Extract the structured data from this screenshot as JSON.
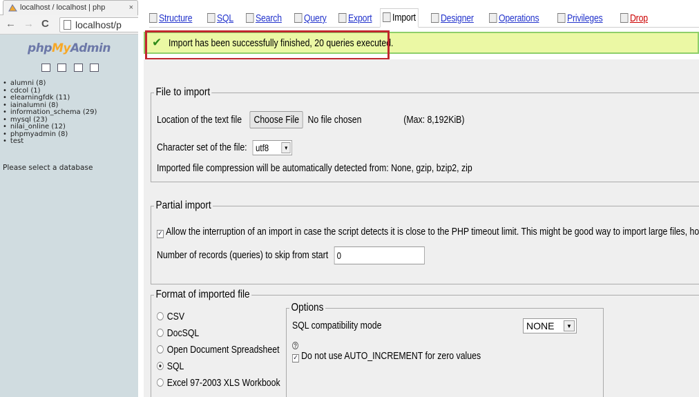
{
  "browser": {
    "tab_title": "localhost / localhost | php",
    "tab_close": "×",
    "url": "localhost/p",
    "back": "←",
    "forward": "→",
    "reload": "C"
  },
  "sidebar": {
    "logo": {
      "part1": "php",
      "part2": "My",
      "part3": "Admin"
    },
    "databases": [
      "alumni (8)",
      "cdcol (1)",
      "elearningfdk (11)",
      "iainalumni (8)",
      "information_schema (29)",
      "mysql (23)",
      "nilai_online (12)",
      "phpmyadmin (8)",
      "test"
    ],
    "select_message": "Please select a database"
  },
  "menu": {
    "structure": "Structure",
    "sql": "SQL",
    "search": "Search",
    "query": "Query",
    "export": "Export",
    "import": "Import",
    "designer": "Designer",
    "operations": "Operations",
    "privileges": "Privileges",
    "drop": "Drop"
  },
  "success": {
    "message": "Import has been successfully finished, 20 queries executed."
  },
  "file_import": {
    "legend": "File to import",
    "location_label": "Location of the text file",
    "choose_button": "Choose File",
    "no_file": "No file chosen",
    "max_size": "(Max: 8,192KiB)",
    "charset_label": "Character set of the file:",
    "charset_value": "utf8",
    "compression_note": "Imported file compression will be automatically detected from: None, gzip, bzip2, zip"
  },
  "partial_import": {
    "legend": "Partial import",
    "allow_interrupt_label": "Allow the interruption of an import in case the script detects it is close to the PHP timeout limit. This might be good way to import large files, however it",
    "allow_interrupt_checked": true,
    "skip_label": "Number of records (queries) to skip from start",
    "skip_value": "0"
  },
  "format": {
    "legend": "Format of imported file",
    "options": [
      {
        "label": "CSV",
        "selected": false
      },
      {
        "label": "DocSQL",
        "selected": false
      },
      {
        "label": "Open Document Spreadsheet",
        "selected": false
      },
      {
        "label": "SQL",
        "selected": true
      },
      {
        "label": "Excel 97-2003 XLS Workbook",
        "selected": false
      }
    ],
    "options_box": {
      "legend": "Options",
      "compat_label": "SQL compatibility mode",
      "compat_value": "NONE",
      "help": "?",
      "no_auto_increment_label": "Do not use AUTO_INCREMENT for zero values",
      "no_auto_increment_checked": true
    }
  }
}
